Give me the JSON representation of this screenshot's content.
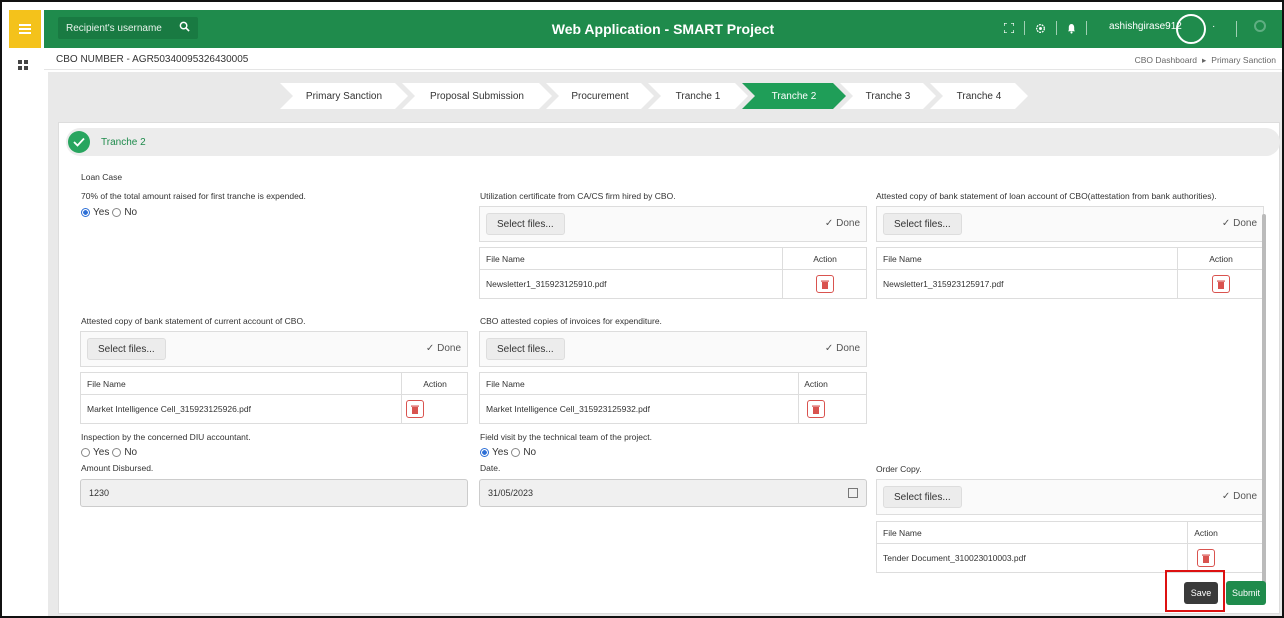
{
  "topbar": {
    "search_placeholder": "Recipient's username",
    "title": "Web Application - SMART Project",
    "username": "ashishgirase912",
    "caret": "·"
  },
  "header": {
    "cbo_number": "CBO NUMBER - AGR50340095326430005",
    "breadcrumb": [
      "CBO Dashboard",
      "▸",
      "Primary Sanction"
    ]
  },
  "steps": [
    {
      "label": "Primary Sanction",
      "active": false
    },
    {
      "label": "Proposal Submission",
      "active": false
    },
    {
      "label": "Procurement",
      "active": false
    },
    {
      "label": "Tranche 1",
      "active": false
    },
    {
      "label": "Tranche 2",
      "active": true
    },
    {
      "label": "Tranche 3",
      "active": false
    },
    {
      "label": "Tranche 4",
      "active": false
    }
  ],
  "section": {
    "title": "Tranche 2",
    "loan_case": "Loan Case"
  },
  "q1": {
    "label": "70% of the total amount raised for first tranche is expended.",
    "yes": "Yes",
    "no": "No",
    "selected": "Yes"
  },
  "uploads": {
    "select_label": "Select files...",
    "done_label": "Done",
    "col_file": "File Name",
    "col_action": "Action",
    "utilization": {
      "label": "Utilization certificate from CA/CS firm hired by CBO.",
      "file": "Newsletter1_315923125910.pdf"
    },
    "loan_statement": {
      "label": "Attested copy of bank statement of loan account of CBO(attestation from bank authorities).",
      "file": "Newsletter1_315923125917.pdf"
    },
    "current_statement": {
      "label": "Attested copy of bank statement of current account of CBO.",
      "file": "Market Intelligence Cell_315923125926.pdf"
    },
    "invoices": {
      "label": "CBO attested copies of invoices for expenditure.",
      "file": "Market Intelligence Cell_315923125932.pdf"
    },
    "order_copy": {
      "label": "Order Copy.",
      "file": "Tender Document_310023010003.pdf"
    }
  },
  "inspection": {
    "label": "Inspection by the concerned DIU accountant.",
    "yes": "Yes",
    "no": "No",
    "selected": "none"
  },
  "field_visit": {
    "label": "Field visit by the technical team of the project.",
    "yes": "Yes",
    "no": "No",
    "selected": "Yes"
  },
  "amount": {
    "label": "Amount Disbursed.",
    "value": "1230"
  },
  "date": {
    "label": "Date.",
    "value": "31/05/2023"
  },
  "actions": {
    "save": "Save",
    "submit": "Submit"
  }
}
